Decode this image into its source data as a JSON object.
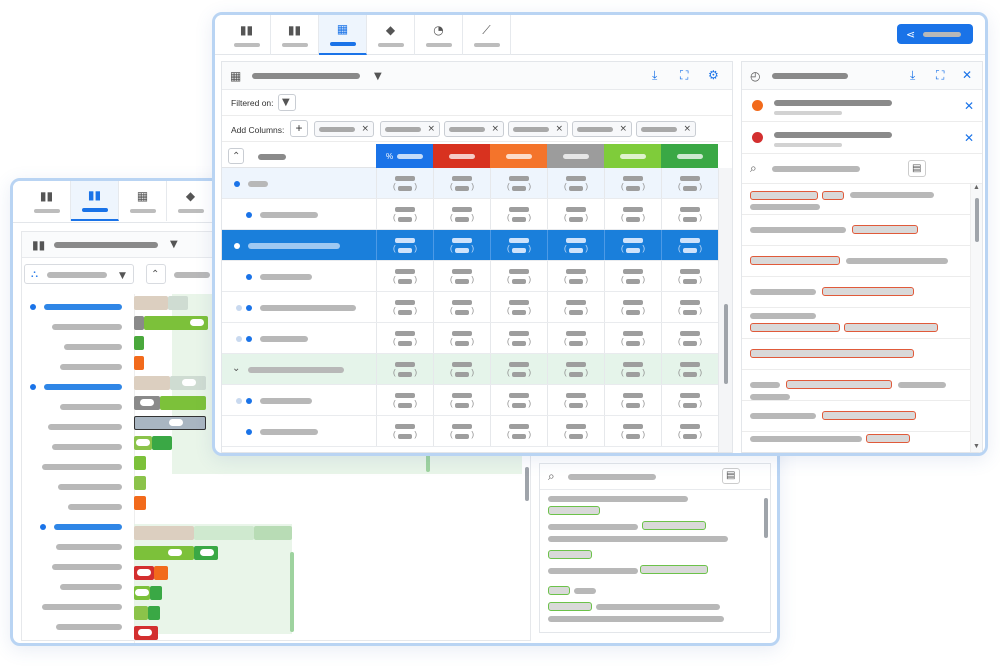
{
  "colors": {
    "accent": "#1a73e8",
    "row_selected": "#1a7fdb",
    "row_group": "#e5f4ea",
    "row_highlight": "#eef5fd",
    "status_orange": "#f26a1b",
    "status_red": "#d32f2f",
    "tag_red": "#e05a3a",
    "tag_green": "#6cc24a"
  },
  "front": {
    "tabs": [
      {
        "icon": "bar-chart-icon",
        "glyph": "▮▮",
        "active": false
      },
      {
        "icon": "stacked-bar-icon",
        "glyph": "▮▮",
        "active": false
      },
      {
        "icon": "table-icon",
        "glyph": "▦",
        "active": true
      },
      {
        "icon": "shapes-icon",
        "glyph": "◆",
        "active": false
      },
      {
        "icon": "gauge-icon",
        "glyph": "◔",
        "active": false
      },
      {
        "icon": "trend-icon",
        "glyph": "⟋",
        "active": false
      }
    ],
    "share_icon": "share-icon",
    "table_panel": {
      "filter_label": "Filtered on:",
      "add_columns_label": "Add Columns:",
      "add_glyph": "+",
      "chip_close": "×",
      "column_headers": [
        {
          "prefix": "%",
          "color": "#1a73e8"
        },
        {
          "prefix": "",
          "color": "#d8321f"
        },
        {
          "prefix": "",
          "color": "#f4742b"
        },
        {
          "prefix": "",
          "color": "#9c9c9c"
        },
        {
          "prefix": "",
          "color": "#7fcc3a"
        },
        {
          "prefix": "",
          "color": "#3aa845"
        }
      ]
    }
  },
  "back": {
    "tabs": [
      {
        "icon": "bar-chart-icon",
        "glyph": "▮▮",
        "active": false
      },
      {
        "icon": "stacked-bar-icon",
        "glyph": "▮▮",
        "active": true
      },
      {
        "icon": "table-icon",
        "glyph": "▦",
        "active": false
      },
      {
        "icon": "shapes-icon",
        "glyph": "◆",
        "active": false
      }
    ]
  }
}
